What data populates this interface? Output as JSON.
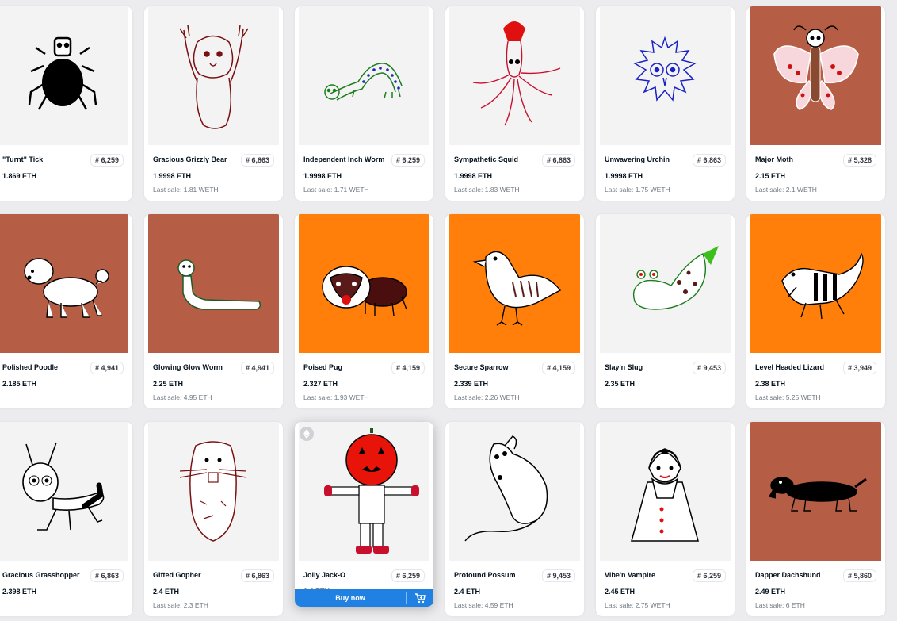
{
  "cards": [
    {
      "name": "\"Turnt\" Tick",
      "rank": "# 6,259",
      "price": "1.869 ETH",
      "last": "",
      "art": "tick",
      "bg": "#f3f3f3"
    },
    {
      "name": "Gracious Grizzly Bear",
      "rank": "# 6,863",
      "price": "1.9998 ETH",
      "last": "Last sale: 1.81 WETH",
      "art": "bear",
      "bg": "#f3f3f3"
    },
    {
      "name": "Independent Inch Worm",
      "rank": "# 6,259",
      "price": "1.9998 ETH",
      "last": "Last sale: 1.71 WETH",
      "art": "worm",
      "bg": "#f3f3f3"
    },
    {
      "name": "Sympathetic Squid",
      "rank": "# 6,863",
      "price": "1.9998 ETH",
      "last": "Last sale: 1.83 WETH",
      "art": "squid",
      "bg": "#f3f3f3"
    },
    {
      "name": "Unwavering Urchin",
      "rank": "# 6,863",
      "price": "1.9998 ETH",
      "last": "Last sale: 1.75 WETH",
      "art": "urchin",
      "bg": "#f3f3f3"
    },
    {
      "name": "Major Moth",
      "rank": "# 5,328",
      "price": "2.15 ETH",
      "last": "Last sale: 2.1 WETH",
      "art": "moth",
      "bg": "#b55d45"
    },
    {
      "name": "Polished Poodle",
      "rank": "# 4,941",
      "price": "2.185 ETH",
      "last": "",
      "art": "poodle",
      "bg": "#b55d45"
    },
    {
      "name": "Glowing Glow Worm",
      "rank": "# 4,941",
      "price": "2.25 ETH",
      "last": "Last sale: 4.95 ETH",
      "art": "glowworm",
      "bg": "#b55d45"
    },
    {
      "name": "Poised Pug",
      "rank": "# 4,159",
      "price": "2.327 ETH",
      "last": "Last sale: 1.93 WETH",
      "art": "pug",
      "bg": "#ff7f0a"
    },
    {
      "name": "Secure Sparrow",
      "rank": "# 4,159",
      "price": "2.339 ETH",
      "last": "Last sale: 2.26 WETH",
      "art": "sparrow",
      "bg": "#ff7f0a"
    },
    {
      "name": "Slay'n Slug",
      "rank": "# 9,453",
      "price": "2.35 ETH",
      "last": "",
      "art": "slug",
      "bg": "#f3f3f3"
    },
    {
      "name": "Level Headed Lizard",
      "rank": "# 3,949",
      "price": "2.38 ETH",
      "last": "Last sale: 5.25 WETH",
      "art": "lizard",
      "bg": "#ff7f0a"
    },
    {
      "name": "Gracious Grasshopper",
      "rank": "# 6,863",
      "price": "2.398 ETH",
      "last": "",
      "art": "grasshopper",
      "bg": "#f3f3f3"
    },
    {
      "name": "Gifted Gopher",
      "rank": "# 6,863",
      "price": "2.4 ETH",
      "last": "Last sale: 2.3 ETH",
      "art": "gopher",
      "bg": "#f3f3f3"
    },
    {
      "name": "Jolly Jack-O",
      "rank": "# 6,259",
      "price": "2.4 ETH",
      "last": "",
      "art": "jacko",
      "bg": "#f3f3f3",
      "buy": "Buy now"
    },
    {
      "name": "Profound Possum",
      "rank": "# 9,453",
      "price": "2.4 ETH",
      "last": "Last sale: 4.59 ETH",
      "art": "possum",
      "bg": "#f3f3f3"
    },
    {
      "name": "Vibe'n Vampire",
      "rank": "# 6,259",
      "price": "2.45 ETH",
      "last": "Last sale: 2.75 WETH",
      "art": "vampire",
      "bg": "#f3f3f3"
    },
    {
      "name": "Dapper Dachshund",
      "rank": "# 5,860",
      "price": "2.49 ETH",
      "last": "Last sale: 6 ETH",
      "art": "dachshund",
      "bg": "#b55d45"
    }
  ]
}
